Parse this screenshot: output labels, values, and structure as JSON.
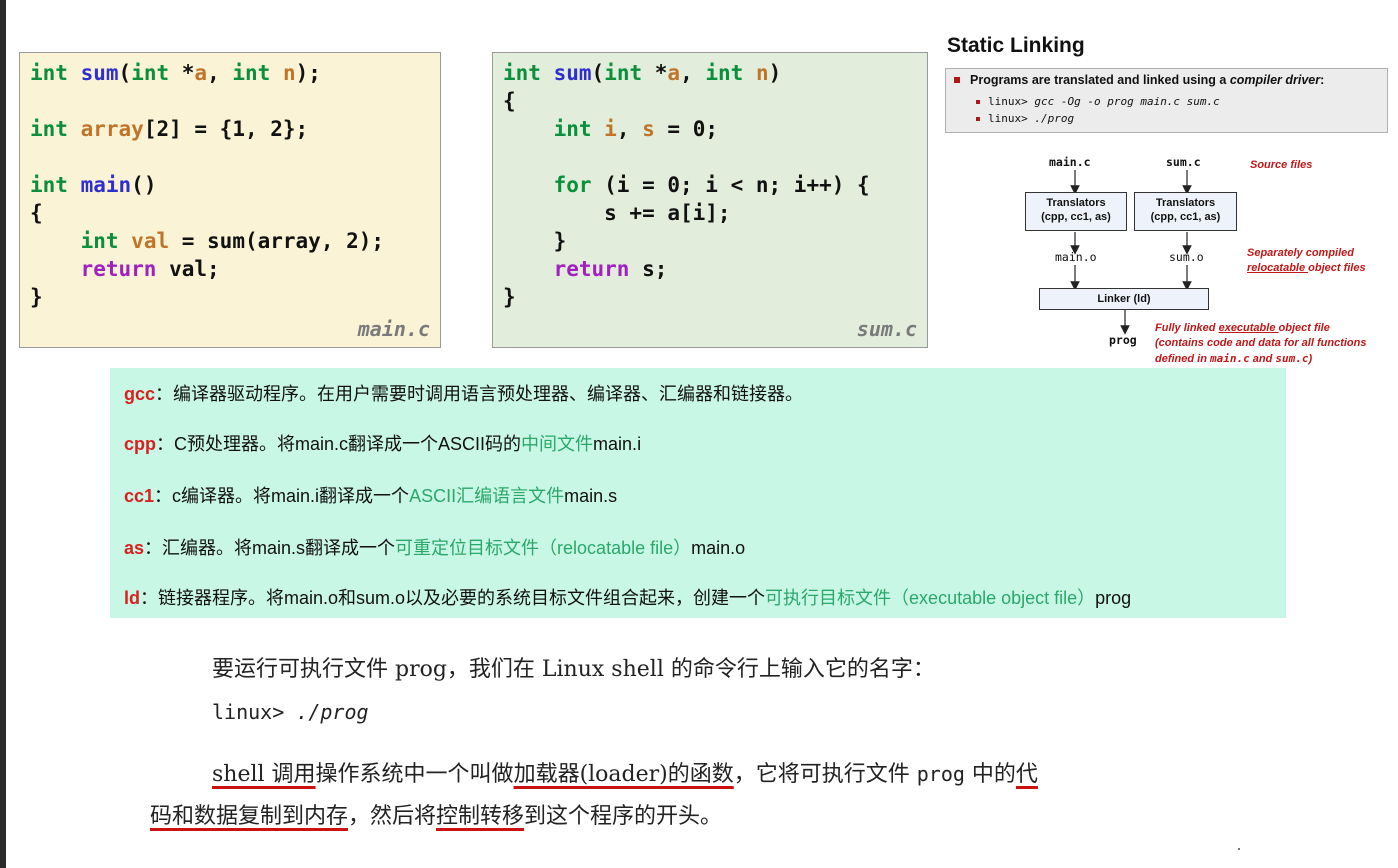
{
  "main_code": {
    "l1": [
      "int",
      " ",
      "sum",
      "(",
      "int",
      " *",
      "a",
      ", ",
      "int",
      " ",
      "n",
      ");"
    ],
    "filename": "main.c"
  },
  "sum_code": {
    "filename": "sum.c"
  },
  "static_linking": {
    "title": "Static Linking",
    "line1_a": "Programs are translated and linked using a ",
    "line1_b": "compiler driver",
    "line1_c": ":",
    "cmd1_prompt": "linux> ",
    "cmd1": "gcc -Og -o prog main.c sum.c",
    "cmd2_prompt": "linux> ",
    "cmd2": "./prog"
  },
  "diagram": {
    "src1": "main.c",
    "src2": "sum.c",
    "source_note": "Source files",
    "t1": "Translators",
    "t1b": "(cpp, cc1, as)",
    "t2": "Translators",
    "t2b": "(cpp, cc1, as)",
    "obj1": "main.o",
    "obj2": "sum.o",
    "obj_note1": "Separately compiled",
    "obj_note2a": "relocatable ",
    "obj_note2b": "object files",
    "linker": "Linker (ld)",
    "prog": "prog",
    "prog_note1a": "Fully linked ",
    "prog_note1b": "executable ",
    "prog_note1c": "object file",
    "prog_note2": "(contains code and data for all functions",
    "prog_note3a": "defined in ",
    "prog_note3b": "main.c",
    "prog_note3c": " and ",
    "prog_note3d": "sum.c",
    "prog_note3e": ")"
  },
  "notes": [
    {
      "key": "gcc",
      "text": "：编译器驱动程序。在用户需要时调用语言预处理器、编译器、汇编器和链接器。"
    },
    {
      "key": "cpp",
      "text1": "：C预处理器。将main.c翻译成一个ASCII码的",
      "green": "中间文件",
      "text2": "main.i"
    },
    {
      "key": "cc1",
      "text1": "：c编译器。将main.i翻译成一个",
      "green": "ASCII汇编语言文件",
      "text2": "main.s"
    },
    {
      "key": "as",
      "text1": "：汇编器。将main.s翻译成一个",
      "green": "可重定位目标文件（relocatable file）",
      "text2": "main.o"
    },
    {
      "key": "ld",
      "text1": "：链接器程序。将main.o和sum.o以及必要的系统目标文件组合起来，创建一个",
      "green": "可执行目标文件（executable object file）",
      "text2": "prog"
    }
  ],
  "book": {
    "p1": "要运行可执行文件 prog，我们在 Linux shell 的命令行上输入它的名字：",
    "p2_prompt": "linux> ",
    "p2_cmd": "./prog",
    "p3_a": "shell 调用",
    "p3_b": "操作系统中一个叫做",
    "p3_c": "加载器(loader)的函数",
    "p3_d": "，它将可执行文件 ",
    "p3_e": "prog",
    "p3_f": " 中的",
    "p3_g": "代",
    "p4_a": "码和数据复制到内存",
    "p4_b": "，然后将",
    "p4_c": "控制转移",
    "p4_d": "到这个程序的开头。"
  }
}
